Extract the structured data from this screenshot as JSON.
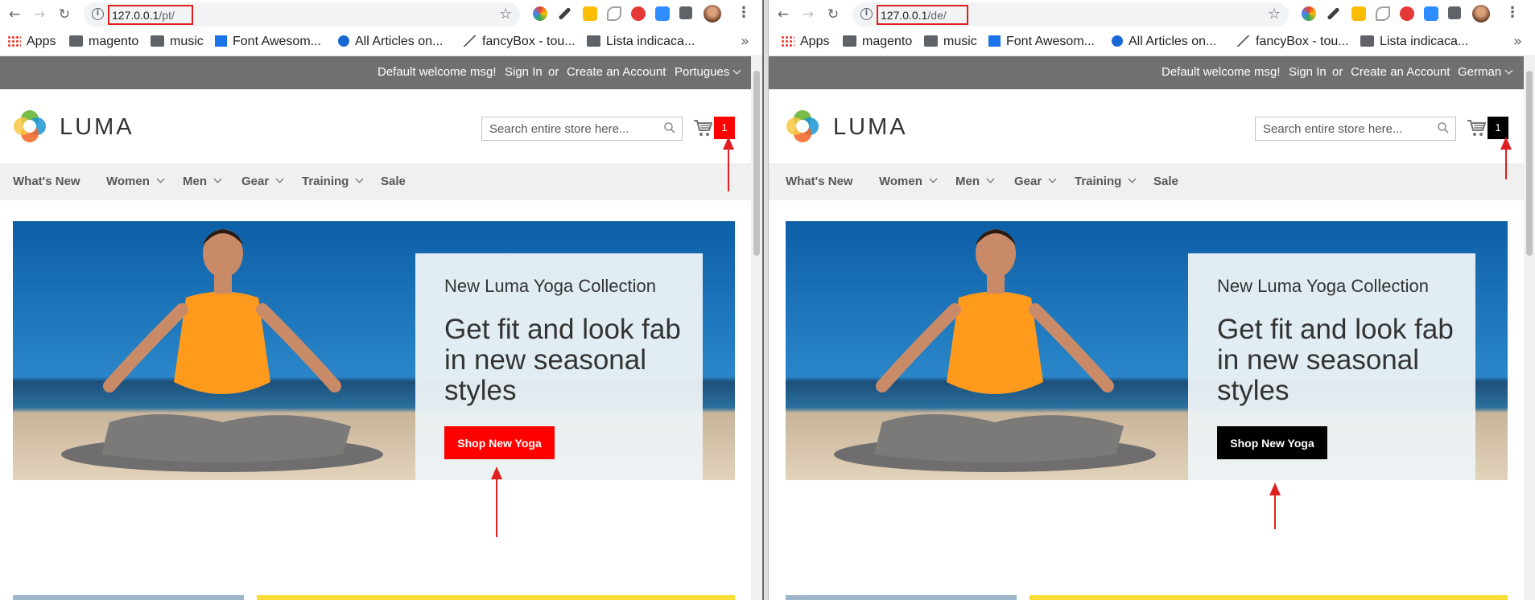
{
  "colors": {
    "left_accent": "#ff0000",
    "right_accent": "#000000",
    "annotation": "#e02020",
    "panel_header_bg": "#6e716e",
    "nav_bg": "#f0f0f0",
    "hero_sky": "#0f63a8",
    "promo_yellow": "#f7dd35",
    "promo_blue": "#9db6c9"
  },
  "browser": {
    "bookmarks": [
      {
        "label": "Apps",
        "icon": "apps-grid-icon"
      },
      {
        "label": "magento",
        "icon": "folder-icon"
      },
      {
        "label": "music",
        "icon": "folder-icon"
      },
      {
        "label": "Font Awesom...",
        "icon": "flag-icon"
      },
      {
        "label": "All Articles on...",
        "icon": "article-icon"
      },
      {
        "label": "fancyBox - tou...",
        "icon": "mountain-icon"
      },
      {
        "label": "Lista indicaca...",
        "icon": "folder-icon"
      }
    ],
    "more": "»"
  },
  "left": {
    "url_host": "127.0.0.1",
    "url_path": "/pt/",
    "language": "Portugues",
    "cart_count": "1"
  },
  "right": {
    "url_host": "127.0.0.1",
    "url_path": "/de/",
    "language": "German",
    "cart_count": "1"
  },
  "store": {
    "welcome": "Default welcome msg!",
    "sign_in": "Sign In",
    "or": "or",
    "create_account": "Create an Account",
    "logo_text": "LUMA",
    "search_placeholder": "Search entire store here...",
    "nav": [
      "What's New",
      "Women",
      "Men",
      "Gear",
      "Training",
      "Sale"
    ],
    "hero": {
      "subtitle": "New Luma Yoga Collection",
      "title": "Get fit and look fab in new seasonal styles",
      "button": "Shop New Yoga"
    }
  }
}
